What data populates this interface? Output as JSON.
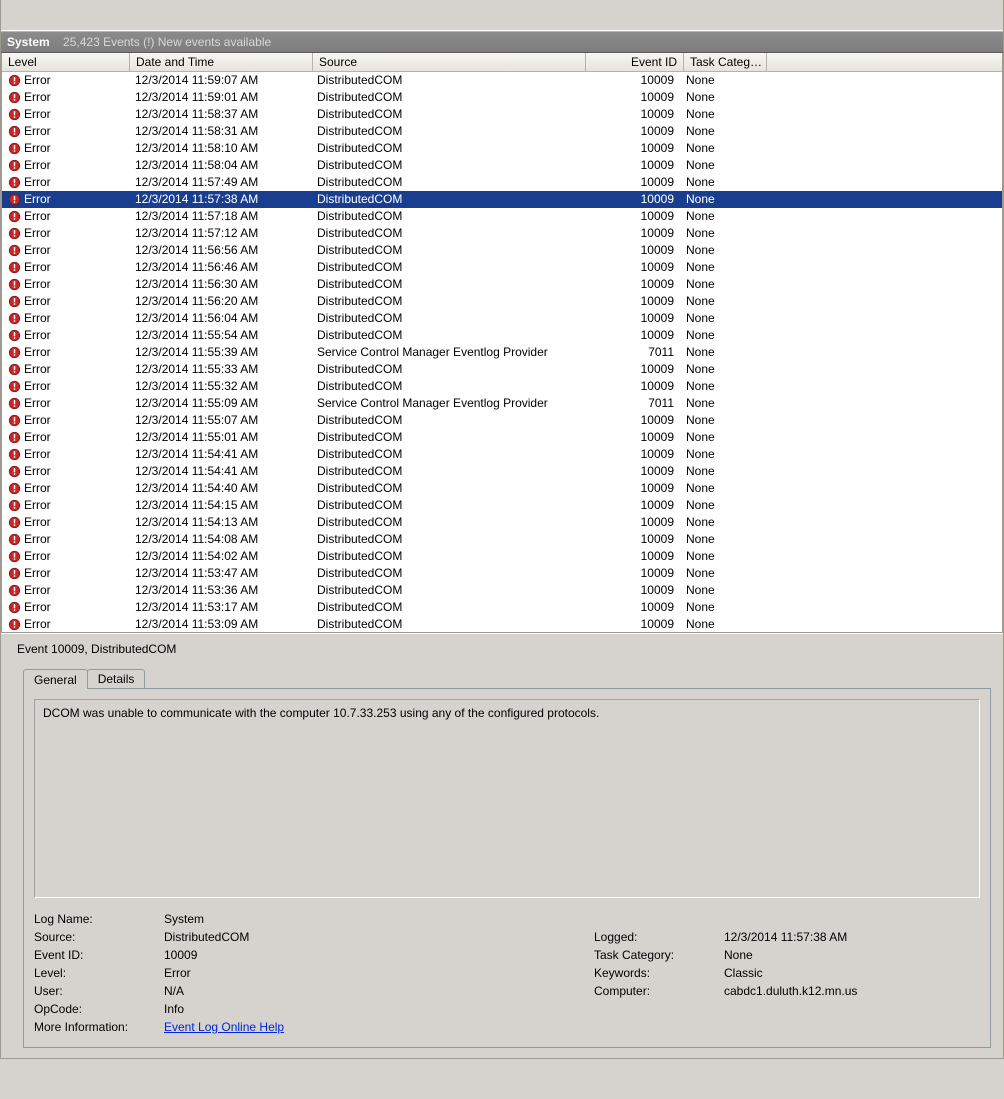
{
  "header": {
    "log": "System",
    "summary": "25,423 Events (!) New events available"
  },
  "columns": {
    "level": "Level",
    "date": "Date and Time",
    "source": "Source",
    "event_id": "Event ID",
    "task_cat": "Task Categ…"
  },
  "selected_index": 7,
  "rows": [
    {
      "level": "Error",
      "date": "12/3/2014 11:59:07 AM",
      "source": "DistributedCOM",
      "id": "10009",
      "tcat": "None"
    },
    {
      "level": "Error",
      "date": "12/3/2014 11:59:01 AM",
      "source": "DistributedCOM",
      "id": "10009",
      "tcat": "None"
    },
    {
      "level": "Error",
      "date": "12/3/2014 11:58:37 AM",
      "source": "DistributedCOM",
      "id": "10009",
      "tcat": "None"
    },
    {
      "level": "Error",
      "date": "12/3/2014 11:58:31 AM",
      "source": "DistributedCOM",
      "id": "10009",
      "tcat": "None"
    },
    {
      "level": "Error",
      "date": "12/3/2014 11:58:10 AM",
      "source": "DistributedCOM",
      "id": "10009",
      "tcat": "None"
    },
    {
      "level": "Error",
      "date": "12/3/2014 11:58:04 AM",
      "source": "DistributedCOM",
      "id": "10009",
      "tcat": "None"
    },
    {
      "level": "Error",
      "date": "12/3/2014 11:57:49 AM",
      "source": "DistributedCOM",
      "id": "10009",
      "tcat": "None"
    },
    {
      "level": "Error",
      "date": "12/3/2014 11:57:38 AM",
      "source": "DistributedCOM",
      "id": "10009",
      "tcat": "None"
    },
    {
      "level": "Error",
      "date": "12/3/2014 11:57:18 AM",
      "source": "DistributedCOM",
      "id": "10009",
      "tcat": "None"
    },
    {
      "level": "Error",
      "date": "12/3/2014 11:57:12 AM",
      "source": "DistributedCOM",
      "id": "10009",
      "tcat": "None"
    },
    {
      "level": "Error",
      "date": "12/3/2014 11:56:56 AM",
      "source": "DistributedCOM",
      "id": "10009",
      "tcat": "None"
    },
    {
      "level": "Error",
      "date": "12/3/2014 11:56:46 AM",
      "source": "DistributedCOM",
      "id": "10009",
      "tcat": "None"
    },
    {
      "level": "Error",
      "date": "12/3/2014 11:56:30 AM",
      "source": "DistributedCOM",
      "id": "10009",
      "tcat": "None"
    },
    {
      "level": "Error",
      "date": "12/3/2014 11:56:20 AM",
      "source": "DistributedCOM",
      "id": "10009",
      "tcat": "None"
    },
    {
      "level": "Error",
      "date": "12/3/2014 11:56:04 AM",
      "source": "DistributedCOM",
      "id": "10009",
      "tcat": "None"
    },
    {
      "level": "Error",
      "date": "12/3/2014 11:55:54 AM",
      "source": "DistributedCOM",
      "id": "10009",
      "tcat": "None"
    },
    {
      "level": "Error",
      "date": "12/3/2014 11:55:39 AM",
      "source": "Service Control Manager Eventlog Provider",
      "id": "7011",
      "tcat": "None"
    },
    {
      "level": "Error",
      "date": "12/3/2014 11:55:33 AM",
      "source": "DistributedCOM",
      "id": "10009",
      "tcat": "None"
    },
    {
      "level": "Error",
      "date": "12/3/2014 11:55:32 AM",
      "source": "DistributedCOM",
      "id": "10009",
      "tcat": "None"
    },
    {
      "level": "Error",
      "date": "12/3/2014 11:55:09 AM",
      "source": "Service Control Manager Eventlog Provider",
      "id": "7011",
      "tcat": "None"
    },
    {
      "level": "Error",
      "date": "12/3/2014 11:55:07 AM",
      "source": "DistributedCOM",
      "id": "10009",
      "tcat": "None"
    },
    {
      "level": "Error",
      "date": "12/3/2014 11:55:01 AM",
      "source": "DistributedCOM",
      "id": "10009",
      "tcat": "None"
    },
    {
      "level": "Error",
      "date": "12/3/2014 11:54:41 AM",
      "source": "DistributedCOM",
      "id": "10009",
      "tcat": "None"
    },
    {
      "level": "Error",
      "date": "12/3/2014 11:54:41 AM",
      "source": "DistributedCOM",
      "id": "10009",
      "tcat": "None"
    },
    {
      "level": "Error",
      "date": "12/3/2014 11:54:40 AM",
      "source": "DistributedCOM",
      "id": "10009",
      "tcat": "None"
    },
    {
      "level": "Error",
      "date": "12/3/2014 11:54:15 AM",
      "source": "DistributedCOM",
      "id": "10009",
      "tcat": "None"
    },
    {
      "level": "Error",
      "date": "12/3/2014 11:54:13 AM",
      "source": "DistributedCOM",
      "id": "10009",
      "tcat": "None"
    },
    {
      "level": "Error",
      "date": "12/3/2014 11:54:08 AM",
      "source": "DistributedCOM",
      "id": "10009",
      "tcat": "None"
    },
    {
      "level": "Error",
      "date": "12/3/2014 11:54:02 AM",
      "source": "DistributedCOM",
      "id": "10009",
      "tcat": "None"
    },
    {
      "level": "Error",
      "date": "12/3/2014 11:53:47 AM",
      "source": "DistributedCOM",
      "id": "10009",
      "tcat": "None"
    },
    {
      "level": "Error",
      "date": "12/3/2014 11:53:36 AM",
      "source": "DistributedCOM",
      "id": "10009",
      "tcat": "None"
    },
    {
      "level": "Error",
      "date": "12/3/2014 11:53:17 AM",
      "source": "DistributedCOM",
      "id": "10009",
      "tcat": "None"
    },
    {
      "level": "Error",
      "date": "12/3/2014 11:53:09 AM",
      "source": "DistributedCOM",
      "id": "10009",
      "tcat": "None"
    }
  ],
  "detail": {
    "title": "Event 10009, DistributedCOM",
    "tabs": {
      "general": "General",
      "details": "Details"
    },
    "message": "DCOM was unable to communicate with the computer 10.7.33.253 using any of the configured protocols.",
    "labels": {
      "log_name": "Log Name:",
      "source": "Source:",
      "event_id": "Event ID:",
      "level": "Level:",
      "user": "User:",
      "opcode": "OpCode:",
      "more_info": "More Information:",
      "logged": "Logged:",
      "task_cat": "Task Category:",
      "keywords": "Keywords:",
      "computer": "Computer:"
    },
    "values": {
      "log_name": "System",
      "source": "DistributedCOM",
      "event_id": "10009",
      "level": "Error",
      "user": "N/A",
      "opcode": "Info",
      "logged": "12/3/2014 11:57:38 AM",
      "task_cat": "None",
      "keywords": "Classic",
      "computer": "cabdc1.duluth.k12.mn.us",
      "more_info_link": "Event Log Online Help"
    }
  }
}
